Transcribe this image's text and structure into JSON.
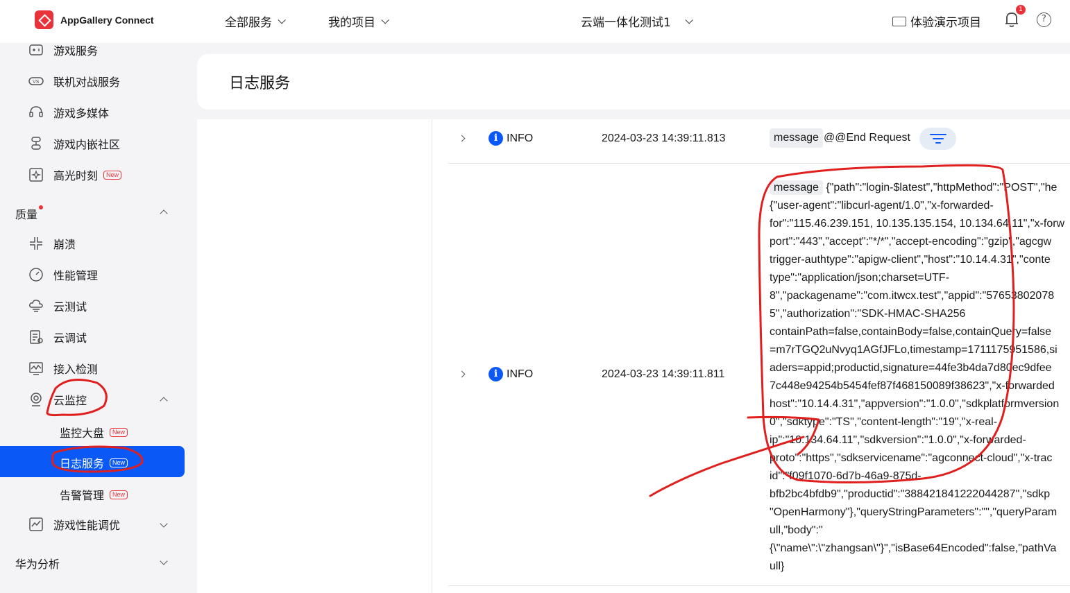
{
  "header": {
    "brand": "AppGallery Connect",
    "nav": [
      "全部服务",
      "我的项目"
    ],
    "project": "云端一体化测试1",
    "demo_label": "体验演示项目",
    "notification_count": "1",
    "help_glyph": "?"
  },
  "sidebar": {
    "top_items": [
      {
        "label": "游戏服务",
        "icon": "game-service-icon"
      },
      {
        "label": "联机对战服务",
        "icon": "vs-icon"
      },
      {
        "label": "游戏多媒体",
        "icon": "multimedia-icon"
      },
      {
        "label": "游戏内嵌社区",
        "icon": "community-icon"
      },
      {
        "label": "高光时刻",
        "icon": "highlight-icon",
        "tag": "New"
      }
    ],
    "quality": {
      "label": "质量",
      "items": [
        {
          "label": "崩溃",
          "icon": "crash-icon"
        },
        {
          "label": "性能管理",
          "icon": "performance-icon"
        },
        {
          "label": "云测试",
          "icon": "cloud-test-icon"
        },
        {
          "label": "云调试",
          "icon": "cloud-debug-icon"
        },
        {
          "label": "接入检测",
          "icon": "access-check-icon"
        },
        {
          "label": "云监控",
          "icon": "cloud-monitor-icon"
        }
      ],
      "monitor_sub": [
        {
          "label": "监控大盘",
          "tag": "New"
        },
        {
          "label": "日志服务",
          "tag": "New",
          "active": true
        },
        {
          "label": "告警管理",
          "tag": "New"
        }
      ],
      "perf_tune": {
        "label": "游戏性能调优",
        "icon": "perf-tune-icon"
      }
    },
    "analytics": {
      "label": "华为分析"
    }
  },
  "main": {
    "title": "日志服务",
    "logs": [
      {
        "level": "INFO",
        "time": "2024-03-23 14:39:11.813",
        "key": "message",
        "value": "@@End Request"
      },
      {
        "level": "INFO",
        "time": "2024-03-23 14:39:11.811",
        "key": "message",
        "lines": [
          " {\"path\":\"login-$latest\",\"httpMethod\":\"POST\",\"he",
          "{\"user-agent\":\"libcurl-agent/1.0\",\"x-forwarded-",
          "for\":\"115.46.239.151, 10.135.135.154, 10.134.64.11\",\"x-forw",
          "port\":\"443\",\"accept\":\"*/*\",\"accept-encoding\":\"gzip\",\"agcgw",
          "trigger-authtype\":\"apigw-client\",\"host\":\"10.14.4.31\",\"conte",
          "type\":\"application/json;charset=UTF-",
          "8\",\"packagename\":\"com.itwcx.test\",\"appid\":\"57653802078",
          "5\",\"authorization\":\"SDK-HMAC-SHA256",
          "containPath=false,containBody=false,containQuery=false",
          "=m7rTGQ2uNvyq1AGfJFLo,timestamp=1711175951586,si",
          "aders=appid;productid,signature=44fe3b4da7d80ec9dfee",
          "7c448e94254b5454fef87f468150089f38623\",\"x-forwarded",
          "host\":\"10.14.4.31\",\"appversion\":\"1.0.0\",\"sdkplatformversion",
          "0\",\"sdktype\":\"TS\",\"content-length\":\"19\",\"x-real-",
          "ip\":\"10.134.64.11\",\"sdkversion\":\"1.0.0\",\"x-forwarded-",
          "proto\":\"https\",\"sdkservicename\":\"agconnect-cloud\",\"x-trac",
          "id\":\"f09f1070-6d7b-46a9-875d-",
          "bfb2bc4bfdb9\",\"productid\":\"388421841222044287\",\"sdkp",
          "\"OpenHarmony\"},\"queryStringParameters\":\"\",\"queryParam",
          "ull,\"body\":\"",
          "{\\\"name\\\":\\\"zhangsan\\\"}\",\"isBase64Encoded\":false,\"pathVa",
          "ull}"
        ]
      }
    ]
  },
  "annotation_color": "#e01f1f",
  "accent_color": "#0a59f7"
}
